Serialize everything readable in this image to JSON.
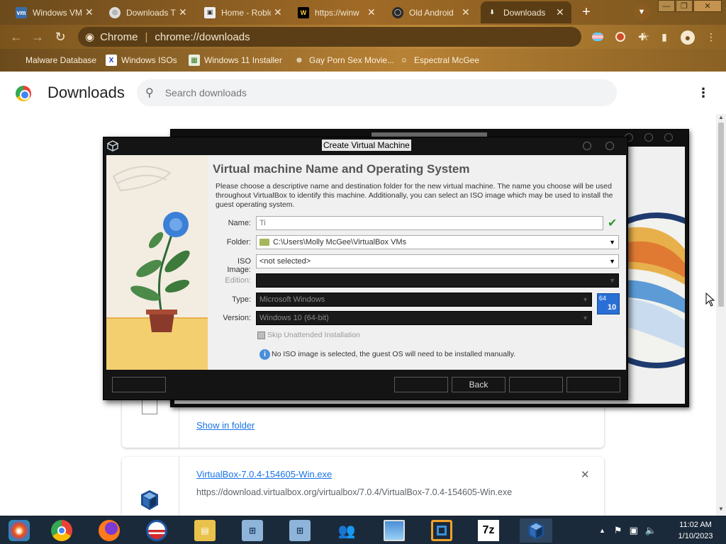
{
  "browser": {
    "tabs": [
      {
        "label": "Windows VM",
        "icon": "vmware-icon",
        "close": "✕"
      },
      {
        "label": "Downloads Ti",
        "icon": "globe-icon",
        "close": "✕"
      },
      {
        "label": "Home - Roblo",
        "icon": "roblox-icon",
        "close": "✕"
      },
      {
        "label": "https://winw",
        "icon": "w-icon",
        "close": "✕"
      },
      {
        "label": "Old Android",
        "icon": "android-icon",
        "close": "✕"
      },
      {
        "label": "Downloads",
        "icon": "download-icon",
        "close": "✕",
        "active": true
      }
    ],
    "new_tab": "+",
    "window_controls": [
      "—",
      "❐",
      "✕"
    ],
    "browser_name": "Chrome",
    "url": "chrome://downloads",
    "bookmarks": [
      {
        "label": "Malware Database"
      },
      {
        "label": "Windows ISOs"
      },
      {
        "label": "Windows 11 Installer"
      },
      {
        "label": "Gay Porn Sex Movie..."
      },
      {
        "label": "Espectral McGee"
      }
    ]
  },
  "downloads": {
    "title": "Downloads",
    "search_placeholder": "Search downloads",
    "menu_icon": "⋮",
    "item1": {
      "link": "Show in folder"
    },
    "item2": {
      "filename": "VirtualBox-7.0.4-154605-Win.exe",
      "url": "https://download.virtualbox.org/virtualbox/7.0.4/VirtualBox-7.0.4-154605-Win.exe",
      "close": "✕"
    }
  },
  "dialog": {
    "title": "Create Virtual Machine",
    "heading": "Virtual machine Name and Operating System",
    "description": "Please choose a descriptive name and destination folder for the new virtual machine. The name you choose will be used throughout VirtualBox to identify this machine. Additionally, you can select an ISO image which may be used to install the guest operating system.",
    "fields": {
      "name_label": "Name:",
      "name_value": "Ti",
      "folder_label": "Folder:",
      "folder_value": "C:\\Users\\Molly McGee\\VirtualBox VMs",
      "iso_label": "ISO Image:",
      "iso_value": "<not selected>",
      "edition_label": "Edition:",
      "edition_value": "",
      "type_label": "Type:",
      "type_value": "Microsoft Windows",
      "version_label": "Version:",
      "version_value": "Windows 10 (64-bit)",
      "skip_unattended_label": "Skip Unattended Installation",
      "os_badge_top": "64",
      "os_badge_num": "10"
    },
    "info_text": "No ISO image is selected, the guest OS will need to be installed manually.",
    "buttons": {
      "help": "",
      "expert": "",
      "back": "Back",
      "next": "",
      "cancel": ""
    }
  },
  "taskbar": {
    "apps": [
      "win7-media-center",
      "chrome",
      "firefox",
      "obama-icon",
      "file-explorer",
      "network-icon",
      "network-icon-2",
      "people-icon",
      "photos-icon",
      "vmware-icon",
      "7zip-icon",
      "virtualbox-icon"
    ],
    "seven_zip_label": "7z",
    "time": "11:02 AM",
    "date": "1/10/2023"
  },
  "colors": {
    "theme_brown": "#a06a26",
    "link_blue": "#1a73e8",
    "vbox_dark": "#141414"
  }
}
